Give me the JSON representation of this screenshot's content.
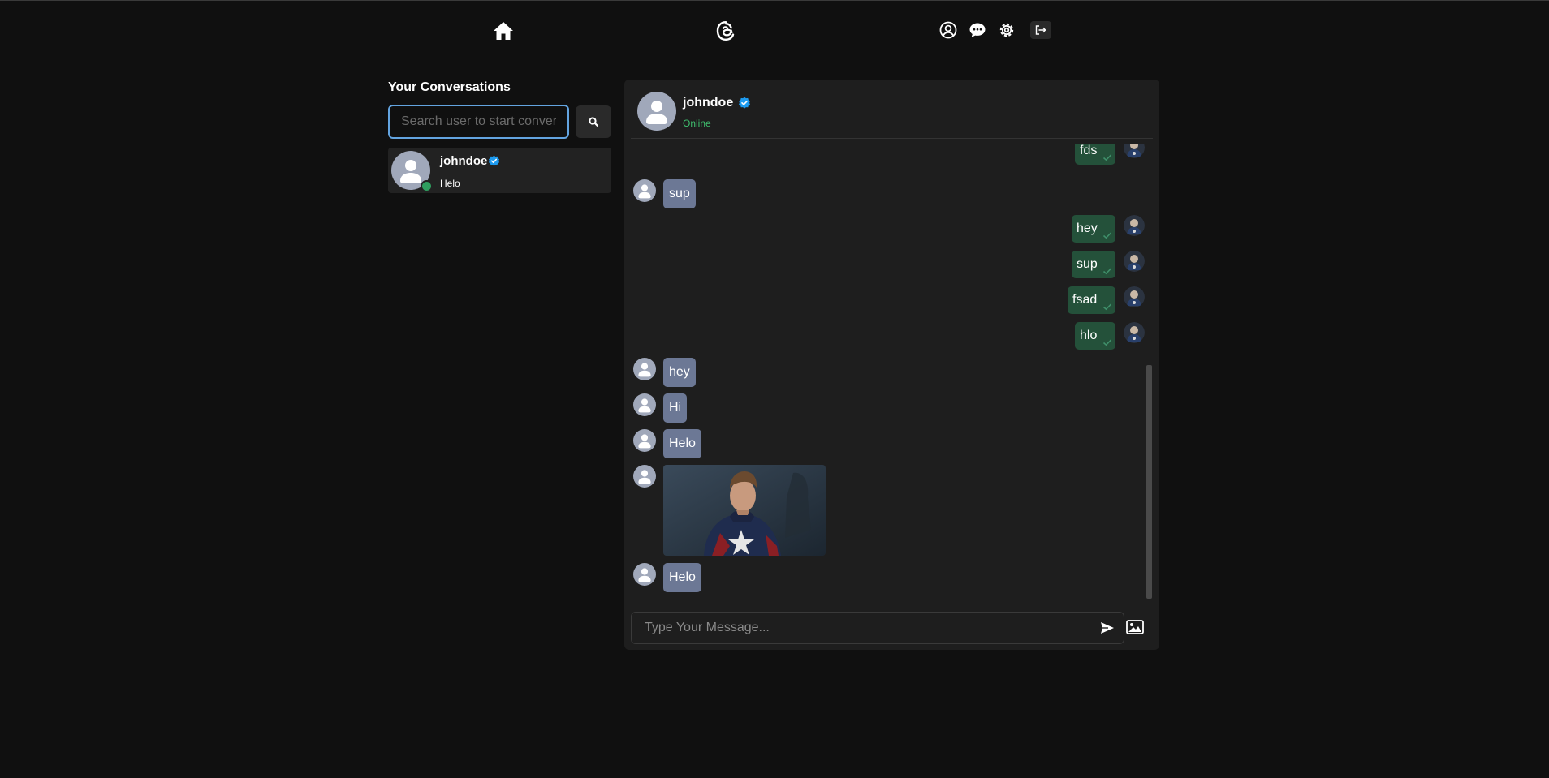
{
  "nav": {
    "icons": [
      "home-icon",
      "threads-logo-icon",
      "profile-icon",
      "chat-icon",
      "settings-icon",
      "logout-icon"
    ]
  },
  "sidebar": {
    "title": "Your Conversations",
    "search_placeholder": "Search user to start conversation",
    "conversations": [
      {
        "username": "johndoe",
        "verified": true,
        "online": true,
        "last_message": "Helo"
      }
    ]
  },
  "chat": {
    "username": "johndoe",
    "verified": true,
    "status": "Online",
    "messages": [
      {
        "from": "me",
        "text": "fds",
        "seen": true
      },
      {
        "from": "other",
        "text": "sup"
      },
      {
        "from": "me",
        "text": "hey",
        "seen": true
      },
      {
        "from": "me",
        "text": "sup",
        "seen": true
      },
      {
        "from": "me",
        "text": "fsad",
        "seen": true
      },
      {
        "from": "me",
        "text": "hlo",
        "seen": true
      },
      {
        "from": "other",
        "text": "hey"
      },
      {
        "from": "other",
        "text": "Hi"
      },
      {
        "from": "other",
        "text": "Helo"
      },
      {
        "from": "other",
        "type": "image",
        "text": ""
      },
      {
        "from": "other",
        "text": "Helo"
      }
    ],
    "composer_placeholder": "Type Your Message..."
  },
  "colors": {
    "background": "#101010",
    "panel": "#1e1e1e",
    "my_bubble": "#24513a",
    "other_bubble": "#6c7895",
    "online": "#3fbf6e",
    "verified": "#1d9bf0",
    "search_focus": "#63a4e0"
  }
}
